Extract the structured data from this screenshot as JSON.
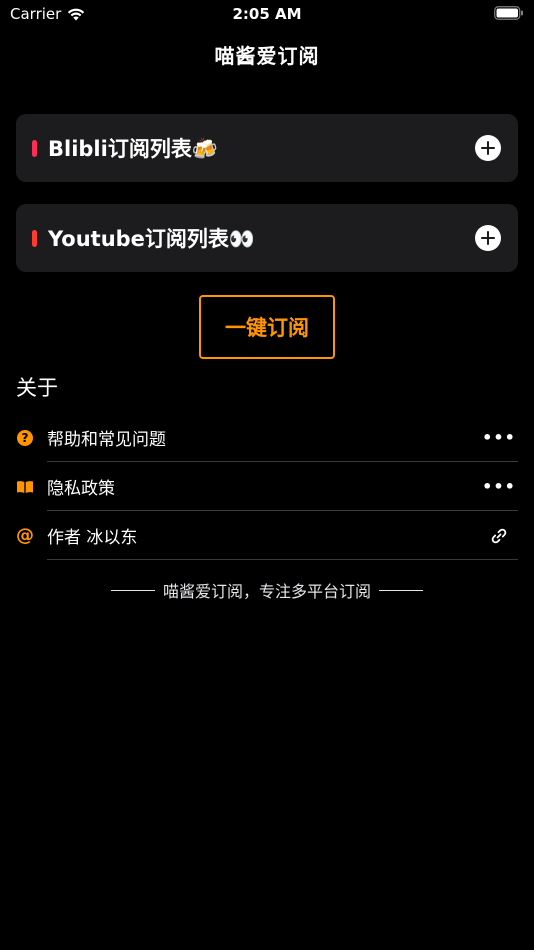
{
  "status_bar": {
    "carrier": "Carrier",
    "time": "2:05 AM"
  },
  "nav": {
    "title": "喵酱爱订阅"
  },
  "subscriptions": [
    {
      "title": "Blibli订阅列表🍻",
      "marker_color": "#ff2d55"
    },
    {
      "title": "Youtube订阅列表👀",
      "marker_color": "#ff3b30"
    }
  ],
  "oneclick_label": "一键订阅",
  "about": {
    "title": "关于",
    "rows": [
      {
        "label": "帮助和常见问题",
        "icon": "question-circle-icon",
        "trailing": "more-icon",
        "trailing_text": "•••",
        "icon_text": "?"
      },
      {
        "label": "隐私政策",
        "icon": "book-icon",
        "trailing": "more-icon",
        "trailing_text": "•••"
      },
      {
        "label": "作者 冰以东",
        "icon": "at-icon",
        "trailing": "link-icon",
        "icon_text": "@"
      }
    ]
  },
  "footer": {
    "text": "喵酱爱订阅，专注多平台订阅"
  },
  "colors": {
    "accent": "#ff9500",
    "background": "#000000",
    "card": "#1c1c1e"
  }
}
